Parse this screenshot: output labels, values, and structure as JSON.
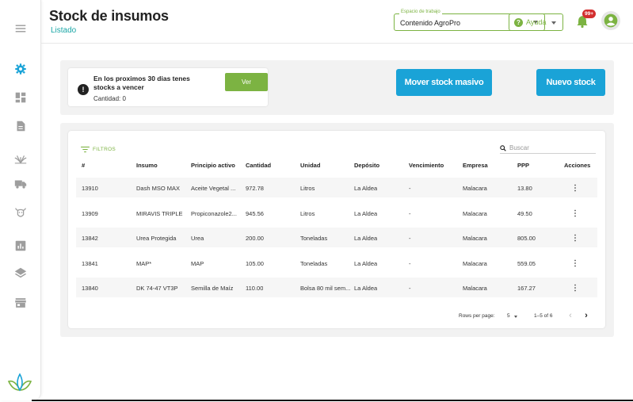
{
  "header": {
    "title": "Stock de insumos",
    "subtitle": "Listado",
    "workspace": {
      "legend": "Espacio de trabajo",
      "value": "Contenido AgroPro"
    },
    "help_label": "Ayuda",
    "notifications_badge": "99+"
  },
  "sidebar": {
    "icons": [
      "menu-icon",
      "gear-icon",
      "dashboard-icon",
      "document-icon",
      "crop-icon",
      "truck-icon",
      "cattle-icon",
      "chart-icon",
      "layers-icon",
      "store-icon",
      "logo-icon"
    ]
  },
  "alert": {
    "text": "En los proximos 30 dias tenes stocks a vencer",
    "count": "Cantidad: 0",
    "ver_label": "Ver"
  },
  "actions": {
    "mover_label": "Mover stock masivo",
    "nuevo_label": "Nuevo stock"
  },
  "table": {
    "filters_label": "FILTROS",
    "search_placeholder": "Buscar",
    "headers": [
      "#",
      "Insumo",
      "Principio activo",
      "Cantidad",
      "Unidad",
      "Depósito",
      "Vencimiento",
      "Empresa",
      "PPP",
      "Acciones"
    ],
    "rows": [
      [
        "13910",
        "Dash MSO MAX",
        "Aceite Vegetal ...",
        "972.78",
        "Litros",
        "La Aldea",
        "-",
        "Malacara",
        "13.80"
      ],
      [
        "13909",
        "MIRAVIS TRIPLE",
        "Propiconazole2...",
        "945.56",
        "Litros",
        "La Aldea",
        "-",
        "Malacara",
        "49.50"
      ],
      [
        "13842",
        "Urea Protegida",
        "Urea",
        "200.00",
        "Toneladas",
        "La Aldea",
        "-",
        "Malacara",
        "805.00"
      ],
      [
        "13841",
        "MAP*",
        "MAP",
        "105.00",
        "Toneladas",
        "La Aldea",
        "-",
        "Malacara",
        "559.05"
      ],
      [
        "13840",
        "DK 74-47 VT3P",
        "Semilla de Maíz",
        "110.00",
        "Bolsa 80 mil sem...",
        "La Aldea",
        "-",
        "Malacara",
        "167.27"
      ]
    ]
  },
  "pagination": {
    "rows_per_page_label": "Rows per page:",
    "rows_per_page_value": "5",
    "range": "1–5 of 6"
  },
  "colors": {
    "accent_green": "#7cb342",
    "accent_blue": "#1aa3d7",
    "teal_link": "#1aa6a6",
    "badge_red": "#d32f2f",
    "sidebar_icon": "#9e9e9e",
    "sidebar_active": "#1aa3d7"
  }
}
